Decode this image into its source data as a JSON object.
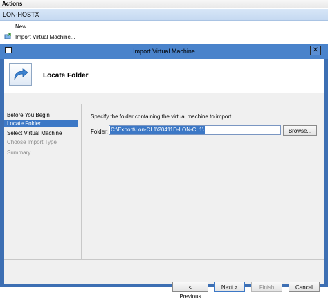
{
  "actions_pane": {
    "header": "Actions",
    "host": "LON-HOSTX",
    "items": [
      {
        "label": "New",
        "icon": "none"
      },
      {
        "label": "Import Virtual Machine...",
        "icon": "import-vm-icon"
      }
    ]
  },
  "dialog": {
    "title": "Import Virtual Machine",
    "page_title": "Locate Folder",
    "nav": [
      {
        "label": "Before You Begin",
        "state": "normal"
      },
      {
        "label": "Locate Folder",
        "state": "selected"
      },
      {
        "label": "Select Virtual Machine",
        "state": "normal"
      },
      {
        "label": "Choose Import Type",
        "state": "disabled"
      },
      {
        "label": "Summary",
        "state": "disabled"
      }
    ],
    "instruction": "Specify the folder containing the virtual machine to import.",
    "folder_label": "Folder:",
    "folder_value": "C:\\Export\\Lon-CL1\\20411D-LON-CL1\\",
    "buttons": {
      "browse": "Browse...",
      "previous": "< Previous",
      "next": "Next >",
      "finish": "Finish",
      "cancel": "Cancel"
    }
  },
  "colors": {
    "selection": "#3c78c6",
    "titlebar": "#4a83cb",
    "host_bar": "#c5d9f1"
  }
}
